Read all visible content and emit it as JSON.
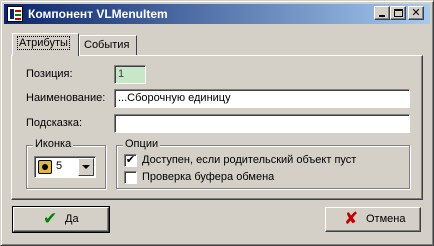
{
  "window": {
    "title": "Компонент VLMenuItem",
    "close_glyph": "✕"
  },
  "tabs": [
    {
      "label": "Атрибуты",
      "active": true
    },
    {
      "label": "События",
      "active": false
    }
  ],
  "form": {
    "position_label": "Позиция:",
    "position_value": "1",
    "name_label": "Наименование:",
    "name_value": "...Сборочную единицу",
    "hint_label": "Подсказка:",
    "hint_value": ""
  },
  "icon_group": {
    "title": "Иконка",
    "selected_value": "5",
    "icon": "toolbox-icon"
  },
  "options_group": {
    "title": "Опции",
    "items": [
      {
        "label": "Доступен, если родительский объект пуст",
        "checked": true
      },
      {
        "label": "Проверка буфера обмена",
        "checked": false
      }
    ],
    "check_glyph": "✔"
  },
  "buttons": {
    "ok_label": "Да",
    "ok_glyph": "✔",
    "ok_color": "#008000",
    "cancel_label": "Отмена",
    "cancel_glyph": "✘",
    "cancel_color": "#c00000"
  }
}
